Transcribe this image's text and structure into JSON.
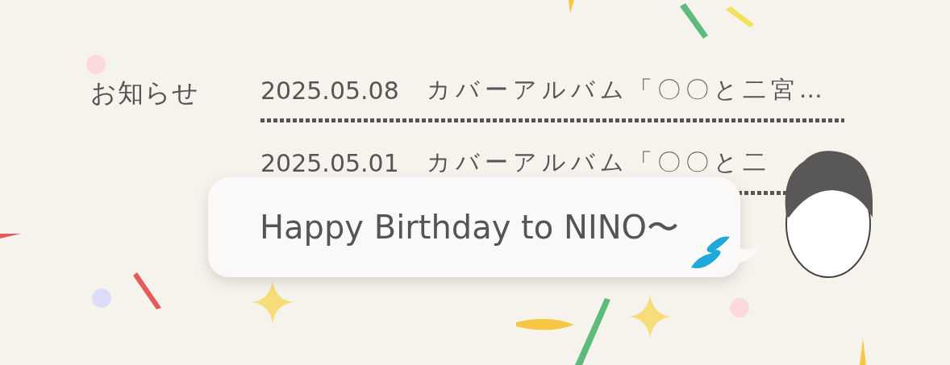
{
  "section": {
    "label": "お知らせ"
  },
  "news": [
    {
      "date": "2025.05.08",
      "title": "カバーアルバム「〇〇と二宮…"
    },
    {
      "date": "2025.05.01",
      "title": "カバーアルバム「〇〇と二"
    }
  ],
  "bubble": {
    "message": "Happy Birthday to NINO〜"
  }
}
